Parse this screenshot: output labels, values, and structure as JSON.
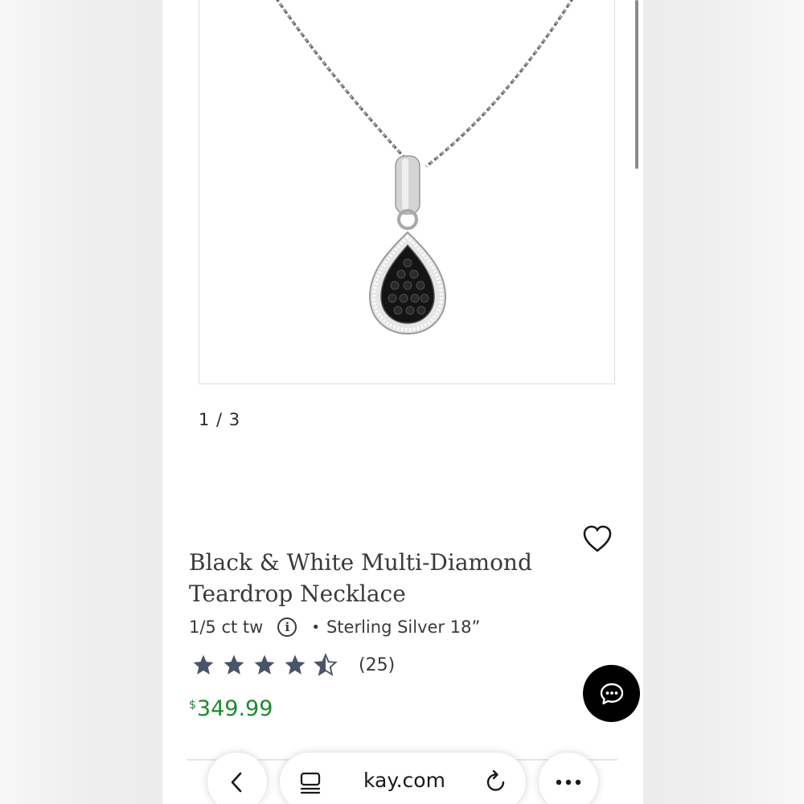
{
  "gallery": {
    "counter": "1 / 3"
  },
  "product": {
    "title_line1": "Black & White Multi-Diamond",
    "title_line2": "Teardrop Necklace",
    "carat": "1/5 ct tw",
    "info_icon": "info-circle-icon",
    "separator": "•",
    "metal": "Sterling Silver 18”",
    "rating": 4.5,
    "rating_max": 5,
    "review_count": "(25)",
    "currency_symbol": "$",
    "price": "349.99",
    "wishlist_icon": "heart-outline-icon"
  },
  "chat": {
    "icon": "chat-bubble-icon",
    "color": "#000000"
  },
  "browser": {
    "url": "kay.com",
    "back_icon": "chevron-left-icon",
    "tabs_icon": "tabs-icon",
    "reload_icon": "reload-icon",
    "more_icon": "more-dots-icon"
  },
  "colors": {
    "price": "#1f8a2e",
    "star": "#4a5468",
    "text": "#3a3a3a"
  }
}
